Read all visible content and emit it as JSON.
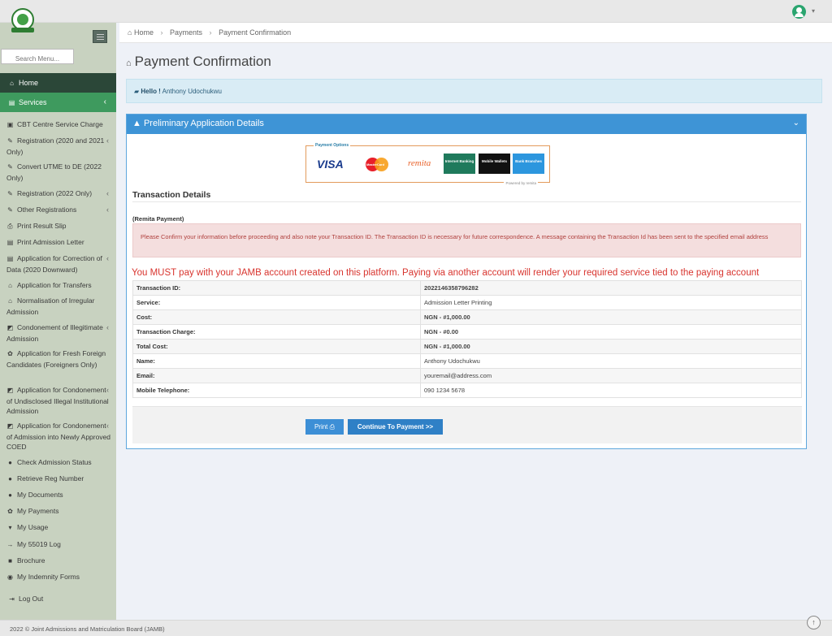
{
  "header": {
    "logo_icon": "jamb-logo",
    "user_icon": "user-icon",
    "caret_icon": "caret-down-icon"
  },
  "sidebar": {
    "search_placeholder": "Search Menu...",
    "home_label": "Home",
    "services_label": "Services",
    "items": [
      {
        "icon": "▣",
        "icon_name": "card-icon",
        "label": "CBT Centre Service Charge",
        "chevron": false
      },
      {
        "icon": "✎",
        "icon_name": "edit-icon",
        "label": "Registration (2020 and 2021 Only)",
        "chevron": true
      },
      {
        "icon": "✎",
        "icon_name": "edit-icon",
        "label": "Convert UTME to DE (2022 Only)",
        "chevron": false
      },
      {
        "icon": "✎",
        "icon_name": "edit-icon",
        "label": "Registration (2022 Only)",
        "chevron": true
      },
      {
        "icon": "✎",
        "icon_name": "edit-icon",
        "label": "Other Registrations",
        "chevron": true
      },
      {
        "icon": "⎙",
        "icon_name": "print-icon",
        "label": "Print Result Slip",
        "chevron": false
      },
      {
        "icon": "▤",
        "icon_name": "document-icon",
        "label": "Print Admission Letter",
        "chevron": false
      },
      {
        "icon": "▤",
        "icon_name": "document-icon",
        "label": "Application for Correction of Data (2020 Downward)",
        "chevron": true
      },
      {
        "icon": "⌂",
        "icon_name": "bank-icon",
        "label": "Application for Transfers",
        "chevron": false
      },
      {
        "icon": "⌂",
        "icon_name": "bank-icon",
        "label": "Normalisation of Irregular Admission",
        "chevron": false
      },
      {
        "icon": "◩",
        "icon_name": "edit-square-icon",
        "label": "Condonement of Illegitimate Admission",
        "chevron": true
      },
      {
        "icon": "✿",
        "icon_name": "recycle-icon",
        "label": "Application for Fresh Foreign Candidates (Foreigners Only)",
        "chevron": false
      },
      {
        "icon": "◩",
        "icon_name": "edit-square-icon",
        "label": "Application for Condonement of Undisclosed Illegal Institutional Admission",
        "chevron": true
      },
      {
        "icon": "◩",
        "icon_name": "edit-square-icon",
        "label": "Application for Condonement of Admission into Newly Approved COED",
        "chevron": true
      },
      {
        "icon": "●",
        "icon_name": "globe-icon",
        "label": "Check Admission Status",
        "chevron": false
      },
      {
        "icon": "●",
        "icon_name": "globe-icon",
        "label": "Retrieve Reg Number",
        "chevron": false
      },
      {
        "icon": "●",
        "icon_name": "globe-icon",
        "label": "My Documents",
        "chevron": false
      },
      {
        "icon": "✿",
        "icon_name": "recycle-icon",
        "label": "My Payments",
        "chevron": false
      },
      {
        "icon": "▾",
        "icon_name": "cart-icon",
        "label": "My Usage",
        "chevron": false
      },
      {
        "icon": "→",
        "icon_name": "arrow-right-icon",
        "label": "My 55019 Log",
        "chevron": false
      },
      {
        "icon": "■",
        "icon_name": "book-icon",
        "label": "Brochure",
        "chevron": false
      },
      {
        "icon": "◉",
        "icon_name": "circle-arrow-icon",
        "label": "My Indemnity Forms",
        "chevron": false
      }
    ],
    "logout_label": "Log Out"
  },
  "breadcrumb": {
    "home": "Home",
    "payments": "Payments",
    "current": "Payment Confirmation"
  },
  "page": {
    "title": "Payment Confirmation",
    "hello_label": "Hello !",
    "hello_name": "Anthony Udochukwu"
  },
  "panel": {
    "title": "Preliminary Application Details",
    "payment_options": {
      "label": "Payment Options",
      "visa": "VISA",
      "mastercard": "MasterCard",
      "remita": "remita",
      "internet_banking": "Internet Banking",
      "mobile_wallets": "Mobile Wallets",
      "bank_branches": "Bank Branches",
      "powered_by": "Powered by remita"
    },
    "section_title": "Transaction Details",
    "remita_label": "(Remita Payment)",
    "alert": "Please Confirm your information before proceeding and also note your Transaction ID. The Transaction ID is necessary for future correspondence. A message containing the Transaction Id has been sent to the specified email address",
    "warning": "You MUST pay with your JAMB account created on this platform. Paying via another account will render your required service tied to the paying account",
    "rows": [
      {
        "key": "Transaction ID:",
        "value": "2022146358796282",
        "bold": true
      },
      {
        "key": "Service:",
        "value": "Admission Letter Printing",
        "bold": false
      },
      {
        "key": "Cost:",
        "value": "NGN - #1,000.00",
        "bold": true
      },
      {
        "key": "Transaction Charge:",
        "value": "NGN - #0.00",
        "bold": true
      },
      {
        "key": "Total Cost:",
        "value": "NGN - #1,000.00",
        "bold": true
      },
      {
        "key": "Name:",
        "value": "Anthony Udochukwu",
        "bold": false
      },
      {
        "key": "Email:",
        "value": "youremail@address.com",
        "bold": false
      },
      {
        "key": "Mobile Telephone:",
        "value": "090 1234 5678",
        "bold": false
      }
    ],
    "print_label": "Print",
    "continue_label": "Continue To Payment >>"
  },
  "footer": {
    "text": "2022 © Joint Admissions and Matriculation Board (JAMB)"
  }
}
